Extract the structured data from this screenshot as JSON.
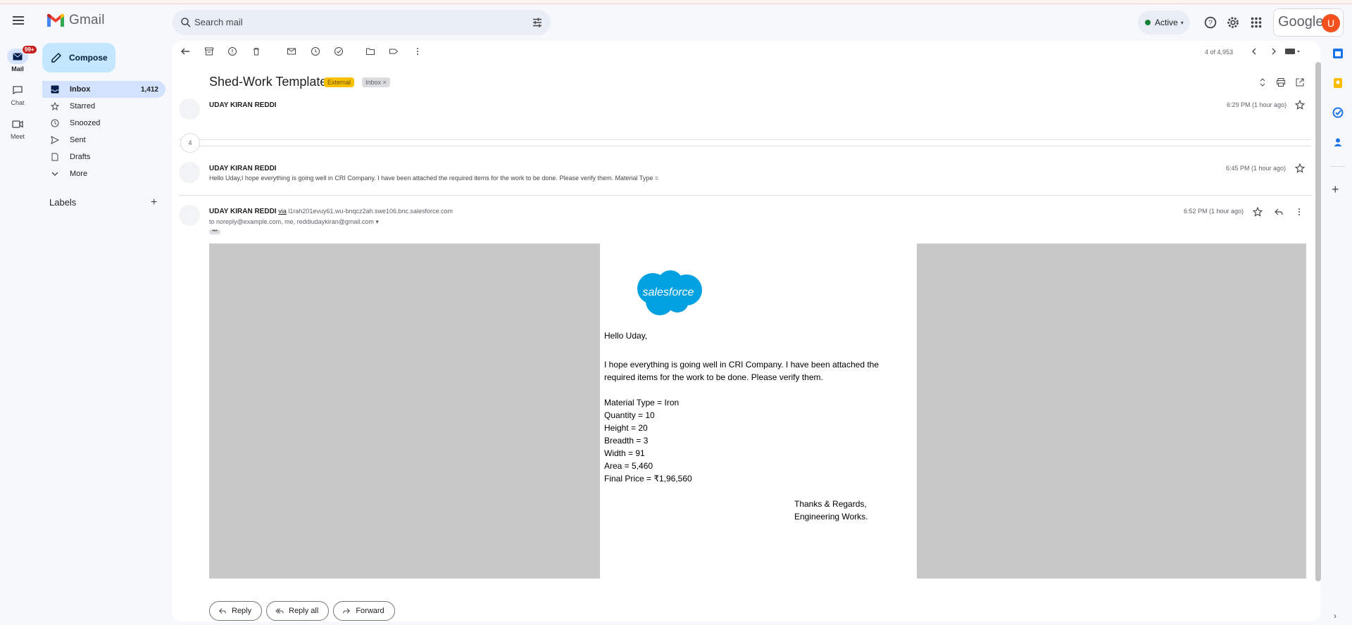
{
  "app": {
    "name": "Gmail",
    "google_label": "Google",
    "avatar_initial": "U"
  },
  "search": {
    "placeholder": "Search mail"
  },
  "status": {
    "label": "Active",
    "color": "#188038"
  },
  "rail": {
    "mail_label": "Mail",
    "mail_badge": "99+",
    "chat_label": "Chat",
    "meet_label": "Meet"
  },
  "compose": {
    "label": "Compose"
  },
  "nav": {
    "items": [
      {
        "label": "Inbox",
        "count": "1,412",
        "icon": "inbox-icon"
      },
      {
        "label": "Starred",
        "count": "",
        "icon": "star-icon"
      },
      {
        "label": "Snoozed",
        "count": "",
        "icon": "clock-icon"
      },
      {
        "label": "Sent",
        "count": "",
        "icon": "send-icon"
      },
      {
        "label": "Drafts",
        "count": "",
        "icon": "draft-icon"
      },
      {
        "label": "More",
        "count": "",
        "icon": "chevron-down-icon"
      }
    ]
  },
  "labels": {
    "title": "Labels"
  },
  "toolbar": {
    "page_count": "4 of 4,953"
  },
  "thread": {
    "subject": "Shed-Work Template",
    "tag_external": "External",
    "tag_inbox": "Inbox ×",
    "collapsed_count": "4",
    "messages": [
      {
        "sender": "UDAY KIRAN REDDI",
        "time": "6:29 PM (1 hour ago)",
        "snippet": ""
      },
      {
        "sender": "UDAY KIRAN REDDI",
        "time": "6:45 PM (1 hour ago)",
        "snippet": "Hello Uday,I hope everything is going well in CRI Company. I have been attached the required items for the work to be done. Please verify them. Material Type ="
      },
      {
        "sender": "UDAY KIRAN REDDI",
        "time": "6:52 PM (1 hour ago)",
        "via_word": "via",
        "via_address": "l1rah201evuy61.wu-bnqcz2ah.swe106.bnc.salesforce.com",
        "to_line": "to noreply@example.com, me, reddiudaykiran@gmail.com"
      }
    ]
  },
  "email": {
    "logo_text": "salesforce",
    "greeting": "Hello Uday,",
    "intro_line1": "I hope everything is going well in CRI Company. I have been attached the",
    "intro_line2": "required items for the work to be done. Please verify them.",
    "details": [
      "Material Type = Iron",
      "Quantity = 10",
      "Height = 20",
      "Breadth = 3",
      "Width = 91",
      "Area = 5,460",
      "Final Price = ₹1,96,560"
    ],
    "sign_line1": "Thanks & Regards,",
    "sign_line2": "Engineering Works."
  },
  "actions": {
    "reply": "Reply",
    "reply_all": "Reply all",
    "forward": "Forward"
  }
}
